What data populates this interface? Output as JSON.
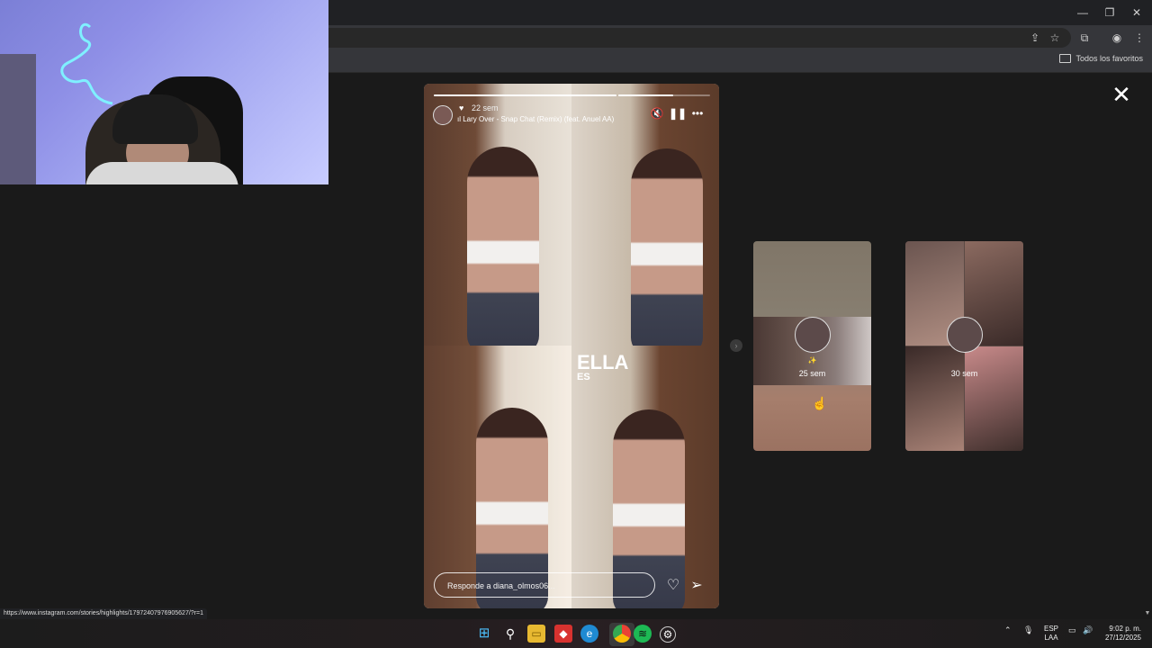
{
  "browser": {
    "bookmarks_all_label": "Todos los favoritos",
    "status_url": "https://www.instagram.com/stories/highlights/17972407976905627/?r=1"
  },
  "story": {
    "time_ago": "22 sem",
    "music": "Lary Over - Snap Chat (Remix) (feat. Anuel AA)",
    "overlay_title": "ELLA",
    "overlay_sub": "ES",
    "reply_placeholder": "Responde a diana_olmos06...",
    "progress_segments": [
      1.0,
      0.6
    ]
  },
  "thumbnails": [
    {
      "label": "25 sem"
    },
    {
      "label": "30 sem"
    }
  ],
  "taskbar": {
    "language_line1": "ESP",
    "language_line2": "LAA",
    "time": "9:02 p. m.",
    "date": "27/12/2025"
  },
  "icons": {
    "window": [
      "minimize-icon",
      "restore-icon",
      "close-window-icon"
    ],
    "toolbar": [
      "install-app-icon",
      "bookmark-star-icon",
      "extensions-icon",
      "profile-icon",
      "more-menu-icon"
    ],
    "story": [
      "heart-icon",
      "mute-icon",
      "pause-icon",
      "more-options-icon",
      "like-icon",
      "share-icon",
      "close-icon"
    ],
    "taskbar": [
      "windows-start-icon",
      "search-icon",
      "file-explorer-icon",
      "app-red-icon",
      "edge-icon",
      "chrome-icon",
      "spotify-icon",
      "settings-app-icon"
    ]
  },
  "colors": {
    "accent_spotify": "#1db954",
    "accent_chrome": "#fbbc05"
  }
}
